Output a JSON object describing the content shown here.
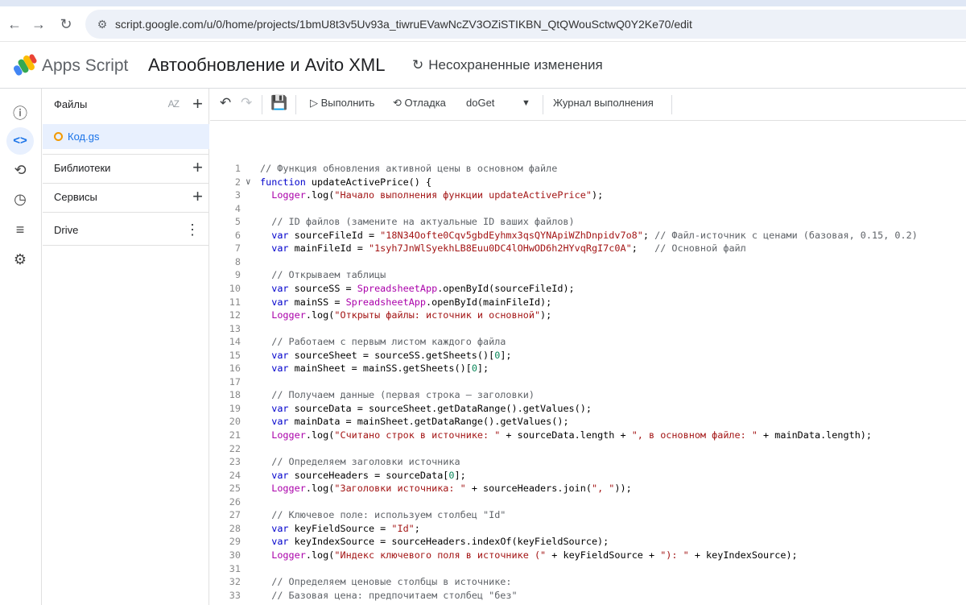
{
  "browser": {
    "url": "script.google.com/u/0/home/projects/1bmU8t3v5Uv93a_tiwruEVawNcZV3OZiSTIKBN_QtQWouSctwQ0Y2Ke70/edit",
    "back_icon": "arrow-left",
    "forward_icon": "arrow-right",
    "reload_icon": "reload"
  },
  "header": {
    "app_name": "Apps Script",
    "project_name": "Автообновление и Avito XML",
    "status": "Несохраненные изменения"
  },
  "files_panel": {
    "files_label": "Файлы",
    "sort_label": "AZ",
    "file_name": "Код.gs",
    "libraries_label": "Библиотеки",
    "services_label": "Сервисы",
    "drive_label": "Drive"
  },
  "toolbar": {
    "run_label": "Выполнить",
    "debug_label": "Отладка",
    "function_name": "doGet",
    "log_label": "Журнал выполнения"
  },
  "colors": {
    "accent": "#1a73e8",
    "active_bg": "#e8f0fe",
    "file_dot": "#f29900"
  },
  "code": {
    "lines": [
      "// Функция обновления активной цены в основном файле",
      "function updateActivePrice() {",
      "  Logger.log(\"Начало выполнения функции updateActivePrice\");",
      "",
      "  // ID файлов (замените на актуальные ID ваших файлов)",
      "  var sourceFileId = \"18N34Oofte0Cqv5gbdEyhmx3qsQYNApiWZhDnpidv7o8\"; // Файл-источник с ценами (базовая, 0.15, 0.2)",
      "  var mainFileId = \"1syh7JnWlSyekhLB8Euu0DC4lOHwOD6h2HYvqRgI7c0A\";   // Основной файл",
      "",
      "  // Открываем таблицы",
      "  var sourceSS = SpreadsheetApp.openById(sourceFileId);",
      "  var mainSS = SpreadsheetApp.openById(mainFileId);",
      "  Logger.log(\"Открыты файлы: источник и основной\");",
      "",
      "  // Работаем с первым листом каждого файла",
      "  var sourceSheet = sourceSS.getSheets()[0];",
      "  var mainSheet = mainSS.getSheets()[0];",
      "",
      "  // Получаем данные (первая строка – заголовки)",
      "  var sourceData = sourceSheet.getDataRange().getValues();",
      "  var mainData = mainSheet.getDataRange().getValues();",
      "  Logger.log(\"Считано строк в источнике: \" + sourceData.length + \", в основном файле: \" + mainData.length);",
      "",
      "  // Определяем заголовки источника",
      "  var sourceHeaders = sourceData[0];",
      "  Logger.log(\"Заголовки источника: \" + sourceHeaders.join(\", \"));",
      "",
      "  // Ключевое поле: используем столбец \"Id\"",
      "  var keyFieldSource = \"Id\";",
      "  var keyIndexSource = sourceHeaders.indexOf(keyFieldSource);",
      "  Logger.log(\"Индекс ключевого поля в источнике (\" + keyFieldSource + \"): \" + keyIndexSource);",
      "",
      "  // Определяем ценовые столбцы в источнике:",
      "  // Базовая цена: предпочитаем столбец \"без\""
    ]
  }
}
